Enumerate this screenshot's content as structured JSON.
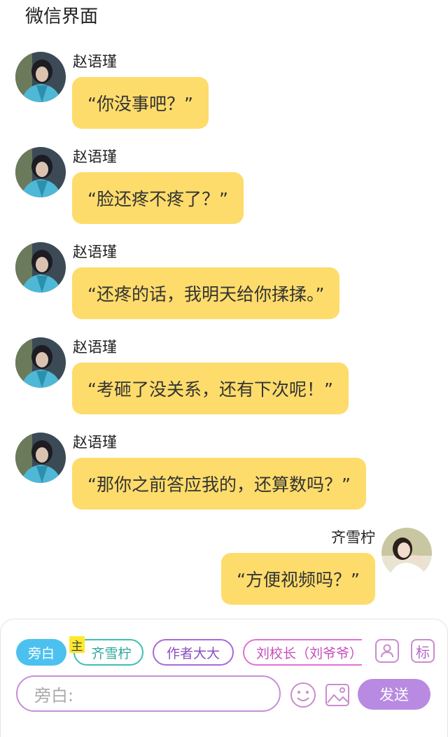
{
  "page_title": "微信界面",
  "messages": [
    {
      "sender": "赵语瑾",
      "text": "“你没事吧？”",
      "side": "left",
      "avatar_icon": "boy-avatar"
    },
    {
      "sender": "赵语瑾",
      "text": "“脸还疼不疼了？”",
      "side": "left",
      "avatar_icon": "boy-avatar"
    },
    {
      "sender": "赵语瑾",
      "text": "“还疼的话，我明天给你揉揉。”",
      "side": "left",
      "avatar_icon": "boy-avatar"
    },
    {
      "sender": "赵语瑾",
      "text": "“考砸了没关系，还有下次呢！”",
      "side": "left",
      "avatar_icon": "boy-avatar"
    },
    {
      "sender": "赵语瑾",
      "text": "“那你之前答应我的，还算数吗？”",
      "side": "left",
      "avatar_icon": "boy-avatar"
    },
    {
      "sender": "齐雪柠",
      "text": "“方便视频吗？”",
      "side": "right",
      "avatar_icon": "girl-avatar"
    }
  ],
  "composer": {
    "roles": [
      {
        "label": "旁白",
        "selected": true
      },
      {
        "label": "齐雪柠",
        "tag": "主"
      },
      {
        "label": "作者大大"
      },
      {
        "label": "刘校长（刘爷爷）"
      }
    ],
    "mark_icon_label": "标",
    "input_placeholder": "旁白:",
    "send_label": "发送"
  },
  "colors": {
    "bubble": "#fedc6b",
    "narration_chip": "#4cc1ef",
    "send_button": "#b88ae2",
    "main_tag": "#fde92e"
  }
}
